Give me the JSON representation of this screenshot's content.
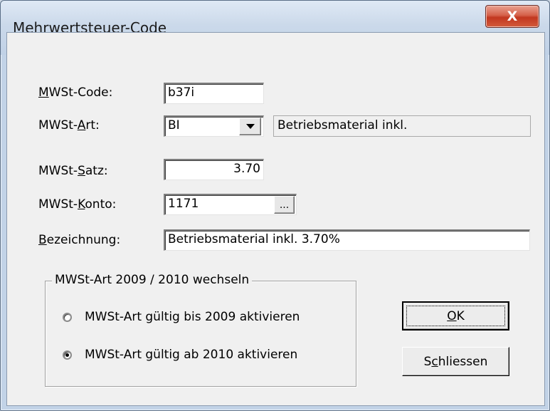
{
  "window": {
    "title": "Mehrwertsteuer-Code",
    "close_glyph": "X"
  },
  "form": {
    "code_label_mnemonic": "M",
    "code_label_rest": "WSt-Code:",
    "code_value": "b37i",
    "art_label_pre": "MWSt-",
    "art_label_mnemonic": "A",
    "art_label_rest": "rt:",
    "art_value": "BI",
    "art_description": "Betriebsmaterial inkl.",
    "satz_label_pre": "MWSt-",
    "satz_label_mnemonic": "S",
    "satz_label_rest": "atz:",
    "satz_value": "3.70",
    "konto_label_pre": "MWSt-",
    "konto_label_mnemonic": "K",
    "konto_label_rest": "onto:",
    "konto_value": "1171",
    "konto_browse_label": "...",
    "bez_label_mnemonic": "B",
    "bez_label_rest": "ezeichnung:",
    "bez_value": "Betriebsmaterial inkl. 3.70%"
  },
  "group": {
    "title": "MWSt-Art 2009 / 2010 wechseln",
    "options": [
      {
        "label": "MWSt-Art gültig bis 2009 aktivieren",
        "selected": false
      },
      {
        "label": "MWSt-Art gültig ab 2010 aktivieren",
        "selected": true
      }
    ]
  },
  "buttons": {
    "ok_mnemonic": "O",
    "ok_rest": "K",
    "close_pre": "S",
    "close_mnemonic": "c",
    "close_rest": "hliessen"
  }
}
